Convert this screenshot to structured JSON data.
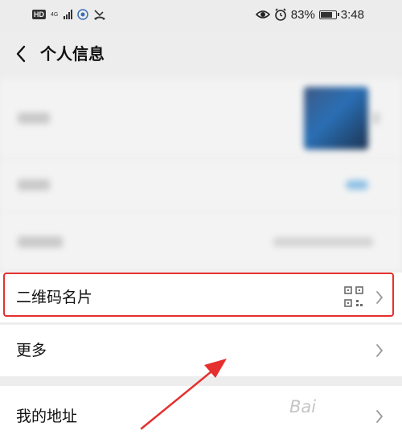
{
  "status_bar": {
    "signal_label": "HD",
    "network_label": "4G",
    "battery_percent": "83%",
    "time": "3:48",
    "icons": [
      "hd-icon",
      "signal-icon",
      "app-icon",
      "missed-call-icon",
      "eye-icon",
      "alarm-icon",
      "battery-icon"
    ]
  },
  "header": {
    "title": "个人信息",
    "back_icon": "back-icon"
  },
  "rows": {
    "qr": {
      "label": "二维码名片",
      "icon": "qr-code-icon"
    },
    "more": {
      "label": "更多"
    },
    "address": {
      "label": "我的地址"
    }
  },
  "annotation": {
    "highlight_color": "#e5302f",
    "arrow_color": "#e5302f"
  },
  "watermark": {
    "text": "Bai"
  }
}
